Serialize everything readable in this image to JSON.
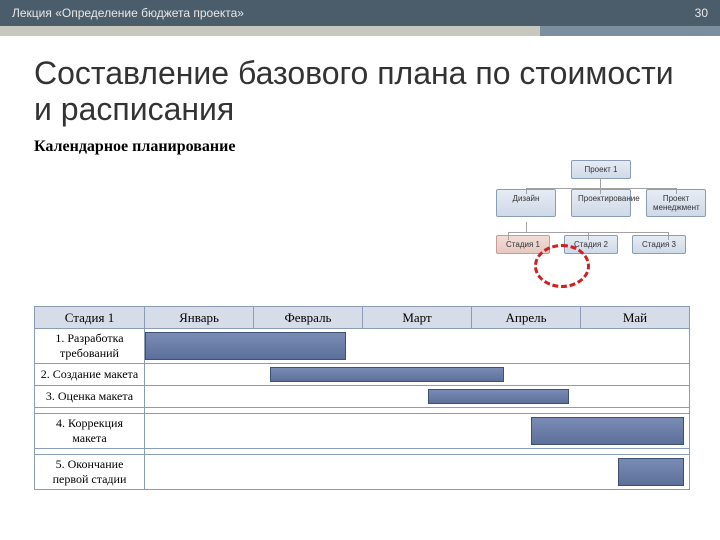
{
  "header": {
    "lecture": "Лекция «Определение бюджета проекта»",
    "slide_no": "30"
  },
  "title": "Составление базового плана по стоимости и расписания",
  "subhead": "Календарное планирование",
  "wbs": {
    "root": "Проект 1",
    "level1": [
      "Дизайн",
      "Проектирование",
      "Проект менеджмент"
    ],
    "level2": [
      "Стадия 1",
      "Стадия 2",
      "Стадия 3"
    ]
  },
  "chart_data": {
    "type": "bar",
    "title": "Стадия 1",
    "categories": [
      "Январь",
      "Февраль",
      "Март",
      "Апрель",
      "Май"
    ],
    "tasks": [
      {
        "name": "1. Разработка требований",
        "start": 0.0,
        "end": 1.85
      },
      {
        "name": "2. Создание макета",
        "start": 1.15,
        "end": 3.3
      },
      {
        "name": "3. Оценка макета",
        "start": 2.6,
        "end": 3.9
      },
      {
        "name": "4. Коррекция макета",
        "start": 3.55,
        "end": 4.95
      },
      {
        "name": "5. Окончание первой стадии",
        "start": 4.35,
        "end": 4.95
      }
    ],
    "xlabel": "",
    "ylabel": ""
  }
}
